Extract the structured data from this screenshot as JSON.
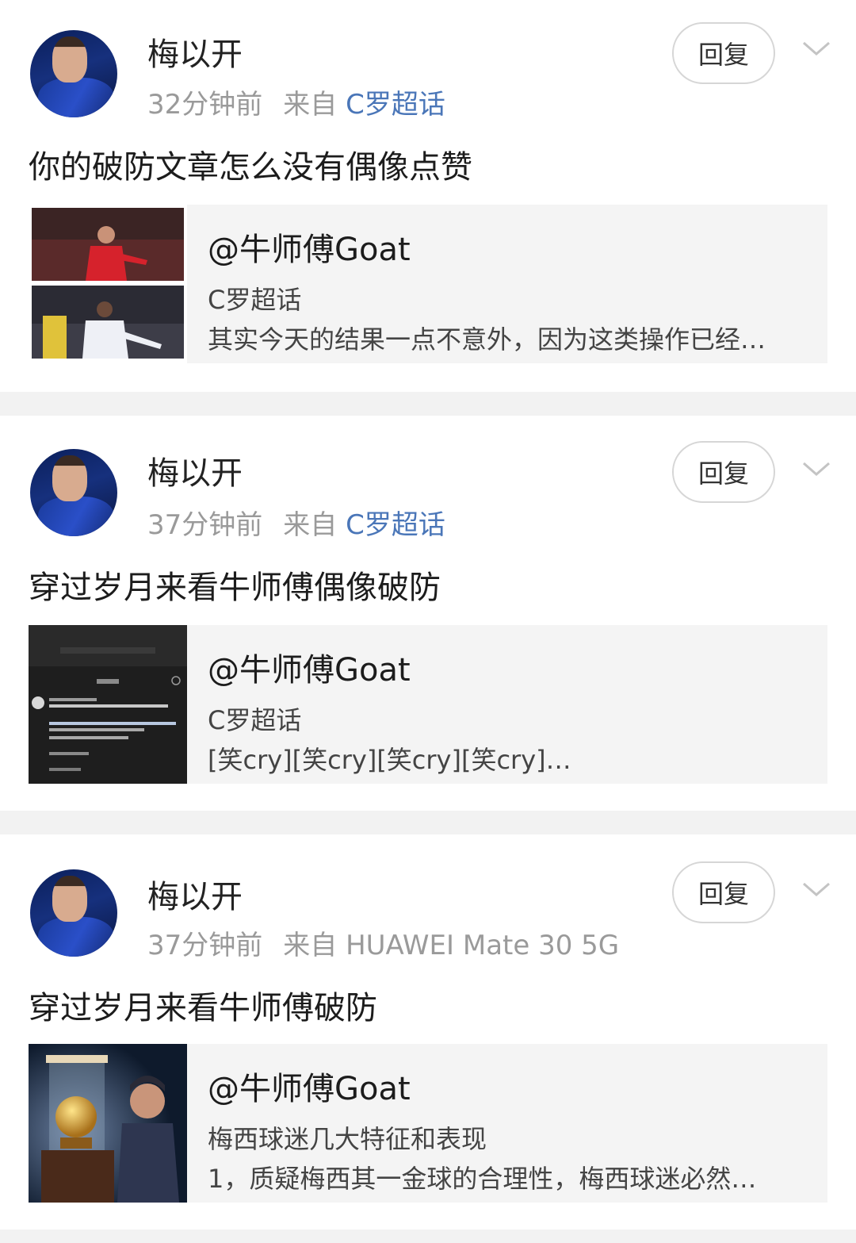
{
  "comments": [
    {
      "username": "梅以开",
      "time": "32分钟前",
      "source_prefix": "来自",
      "source": "C罗超话",
      "source_is_link": true,
      "reply_label": "回复",
      "text": "你的破防文章怎么没有偶像点赞",
      "embed": {
        "author": "@牛师傅Goat",
        "tag": "C罗超话",
        "excerpt": "其实今天的结果一点不意外，因为这类操作已经…",
        "thumb": "football-players-collage"
      }
    },
    {
      "username": "梅以开",
      "time": "37分钟前",
      "source_prefix": "来自",
      "source": "C罗超话",
      "source_is_link": true,
      "reply_label": "回复",
      "text": "穿过岁月来看牛师傅偶像破防",
      "embed": {
        "author": "@牛师傅Goat",
        "tag": "C罗超话",
        "excerpt": "[笑cry][笑cry][笑cry][笑cry]…",
        "thumb": "comment-screenshot"
      }
    },
    {
      "username": "梅以开",
      "time": "37分钟前",
      "source_prefix": "来自",
      "source": "HUAWEI Mate 30 5G",
      "source_is_link": false,
      "reply_label": "回复",
      "text": "穿过岁月来看牛师傅破防",
      "embed": {
        "author": "@牛师傅Goat",
        "tag": "梅西球迷几大特征和表现",
        "excerpt": "1，质疑梅西其一金球的合理性，梅西球迷必然…",
        "thumb": "golden-ball-thief-illustration"
      }
    }
  ],
  "icons": {
    "chevron": "chevron-down-icon",
    "avatar": "avatar"
  },
  "colors": {
    "link": "#4a76b8",
    "meta": "#9a9a9a",
    "divider": "#f2f2f2",
    "embed_bg": "#f4f4f4"
  }
}
